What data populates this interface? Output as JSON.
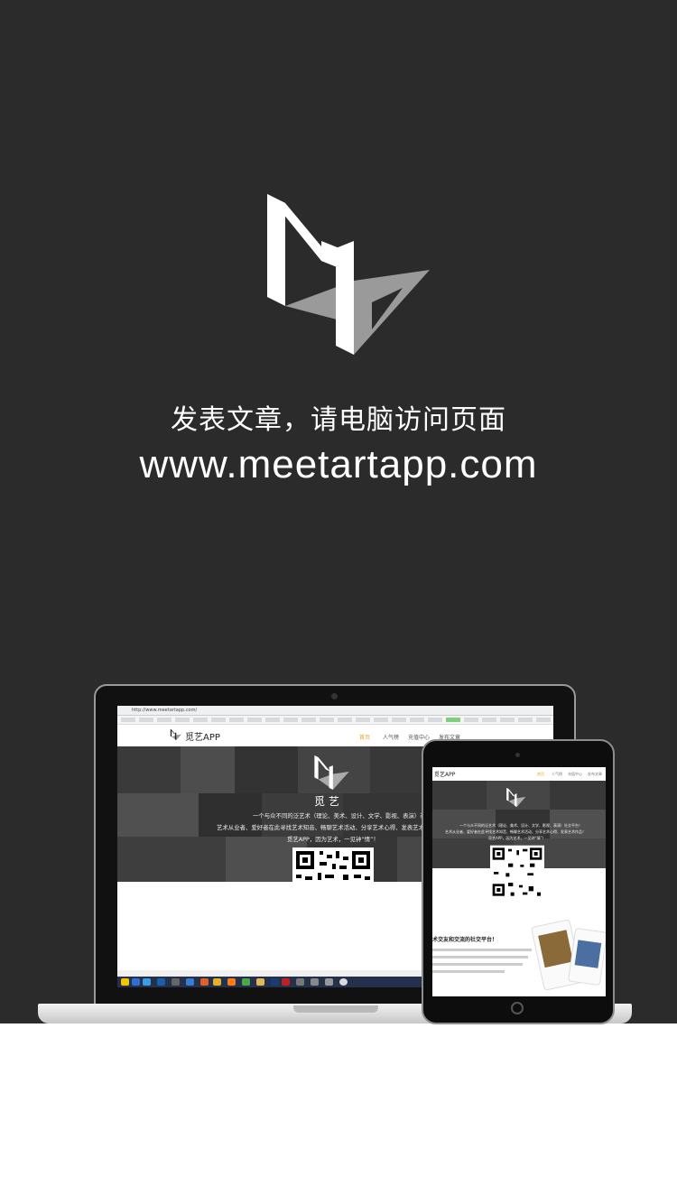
{
  "hero": {
    "tagline": "发表文章，请电脑访问页面",
    "url": "www.meetartapp.com"
  },
  "laptop_screen": {
    "address_bar": "http://www.meetartapp.com/",
    "site_logo": "觅艺APP",
    "nav": [
      "首页",
      "人气榜",
      "充值中心",
      "发布文章"
    ],
    "banner_title": "觅 艺",
    "banner_lines": [
      "一个与众不同的泛艺术（理论、美术、设计、文学、影视、表演）社交平台！",
      "艺术从业者、爱好者在此寻找艺术知音、畅聊艺术活动、分享艺术心得、发表艺术",
      "觅艺APP，因为艺术，一见钟“情”！"
    ]
  },
  "tablet_screen": {
    "site_logo": "觅艺APP",
    "nav": [
      "首页",
      "人气榜",
      "充值中心",
      "发布文章"
    ],
    "banner_title": "觅 艺",
    "banner_lines": [
      "一个与众不同的泛艺术（理论、美术、设计、文学、影视、表演）社交平台！",
      "艺术从业者、爱好者在此寻找艺术知音、畅聊艺术活动、分享艺术心得、发表艺术作品！",
      "觅艺APP，因为艺术，一见钟“情”！"
    ],
    "heading": "术交友和交流的社交平台！"
  },
  "colors": {
    "hero_bg": "#2c2b2c",
    "accent_nav": "#f0a020"
  }
}
